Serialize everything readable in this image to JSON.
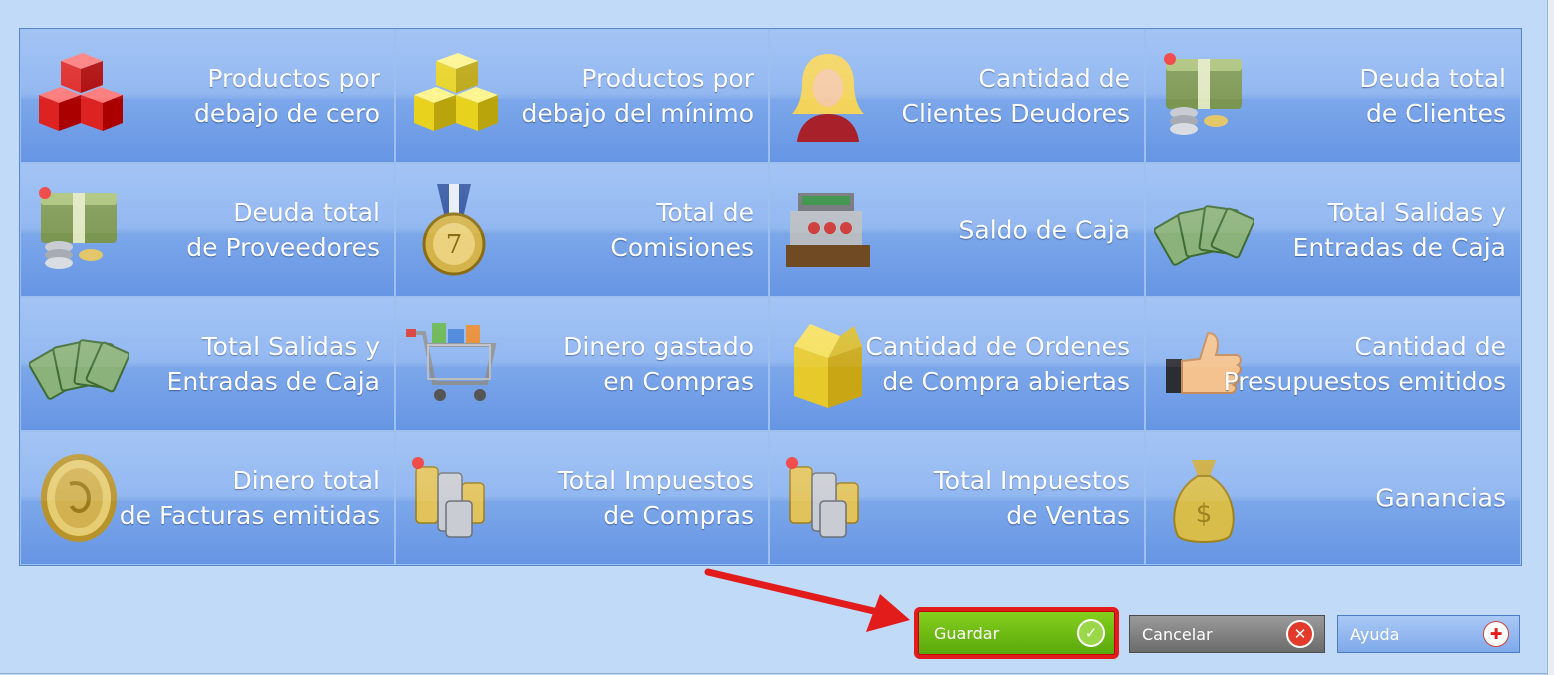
{
  "tiles": [
    {
      "id": "productos-bajo-cero",
      "icon": "red-cubes-icon",
      "line1": "Productos por",
      "line2": "debajo de cero"
    },
    {
      "id": "productos-bajo-minimo",
      "icon": "yellow-cubes-icon",
      "line1": "Productos por",
      "line2": "debajo del mínimo"
    },
    {
      "id": "clientes-deudores",
      "icon": "customer-woman-icon",
      "line1": "Cantidad de",
      "line2": "Clientes Deudores"
    },
    {
      "id": "deuda-clientes",
      "icon": "money-stack-icon",
      "line1": "Deuda total",
      "line2": "de Clientes"
    },
    {
      "id": "deuda-proveedores",
      "icon": "money-stack-icon",
      "line1": "Deuda total",
      "line2": "de Proveedores"
    },
    {
      "id": "total-comisiones",
      "icon": "medal-icon",
      "line1": "Total de",
      "line2": "Comisiones"
    },
    {
      "id": "saldo-caja",
      "icon": "cash-register-icon",
      "line1": "Saldo de Caja",
      "line2": ""
    },
    {
      "id": "salidas-entradas-caja-1",
      "icon": "banknotes-fan-icon",
      "line1": "Total Salidas y",
      "line2": "Entradas de Caja"
    },
    {
      "id": "salidas-entradas-caja-2",
      "icon": "banknotes-fan-icon",
      "line1": "Total Salidas y",
      "line2": "Entradas de Caja"
    },
    {
      "id": "dinero-compras",
      "icon": "shopping-cart-icon",
      "line1": "Dinero gastado",
      "line2": "en Compras"
    },
    {
      "id": "ordenes-compra",
      "icon": "box-icon",
      "line1": "Cantidad de Ordenes",
      "line2": "de Compra abiertas"
    },
    {
      "id": "presupuestos",
      "icon": "thumbs-up-icon",
      "line1": "Cantidad de",
      "line2": "Presupuestos emitidos"
    },
    {
      "id": "dinero-facturas",
      "icon": "gold-coin-icon",
      "line1": "Dinero total",
      "line2": "de Facturas emitidas"
    },
    {
      "id": "impuestos-compras",
      "icon": "coin-stacks-icon",
      "line1": "Total Impuestos",
      "line2": "de Compras"
    },
    {
      "id": "impuestos-ventas",
      "icon": "coin-stacks-icon",
      "line1": "Total Impuestos",
      "line2": "de Ventas"
    },
    {
      "id": "ganancias",
      "icon": "money-bag-icon",
      "line1": "Ganancias",
      "line2": ""
    }
  ],
  "buttons": {
    "save": {
      "label": "Guardar",
      "icon": "check-icon"
    },
    "cancel": {
      "label": "Cancelar",
      "icon": "close-icon"
    },
    "help": {
      "label": "Ayuda",
      "icon": "plus-icon"
    }
  },
  "colors": {
    "accent_arrow": "#e21b1b",
    "save": "#6cbc12",
    "cancel": "#7a7a7a",
    "help": "#8fb4ee"
  }
}
